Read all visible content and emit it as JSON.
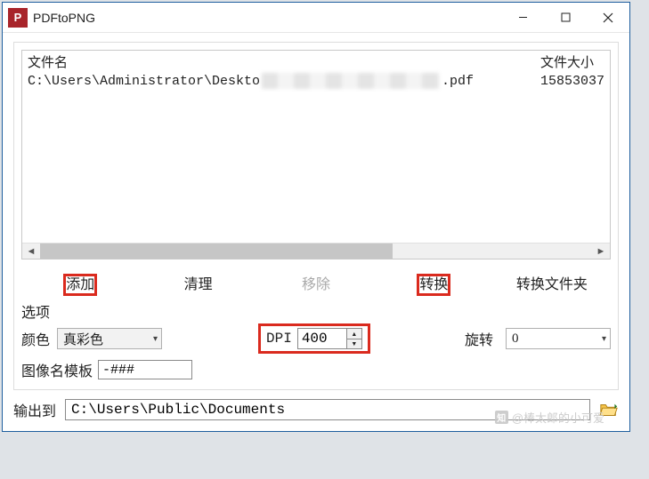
{
  "window": {
    "title": "PDFtoPNG",
    "app_icon_letter": "P"
  },
  "file_table": {
    "header_name": "文件名",
    "header_size": "文件大小",
    "rows": [
      {
        "prefix": "C:\\Users\\Administrator\\Deskto",
        "suffix": ".pdf",
        "size": "15853037"
      }
    ]
  },
  "buttons": {
    "add": "添加",
    "clear": "清理",
    "remove": "移除",
    "convert": "转换",
    "convert_folder": "转换文件夹"
  },
  "options": {
    "section_label": "选项",
    "color_label": "颜色",
    "color_value": "真彩色",
    "dpi_label": "DPI",
    "dpi_value": "400",
    "rotate_label": "旋转",
    "rotate_value": "0",
    "template_label": "图像名模板",
    "template_value": "-###"
  },
  "output": {
    "label": "输出到",
    "path": "C:\\Users\\Public\\Documents"
  },
  "watermark": "@棒太郎的小可爱"
}
